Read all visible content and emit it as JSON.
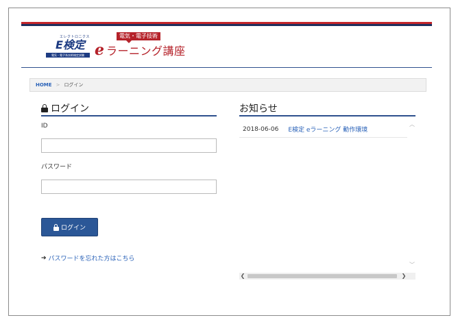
{
  "header": {
    "logo_main": "E検定",
    "logo_tagline_top": "エレクトロニクス",
    "logo_tagline_bottom": "電気・電子系技術検定試験",
    "course_badge": "電気・電子技術",
    "course_title_e": "e",
    "course_title_rest": "ラーニング講座",
    "brand_red": "#c4262b",
    "brand_navy": "#1e2f5e"
  },
  "breadcrumb": {
    "home": "HOME",
    "separator": ">",
    "current": "ログイン"
  },
  "login": {
    "title": "ログイン",
    "id_label": "ID",
    "id_value": "",
    "password_label": "パスワード",
    "password_value": "",
    "submit_label": "ログイン",
    "forgot_link": "パスワードを忘れた方はこちら"
  },
  "news": {
    "title": "お知らせ",
    "items": [
      {
        "date": "2018-06-06",
        "text": "E検定 eラーニング 動作環境"
      }
    ]
  },
  "icons": {
    "lock": "lock-icon",
    "arrow": "arrow-right-icon"
  }
}
